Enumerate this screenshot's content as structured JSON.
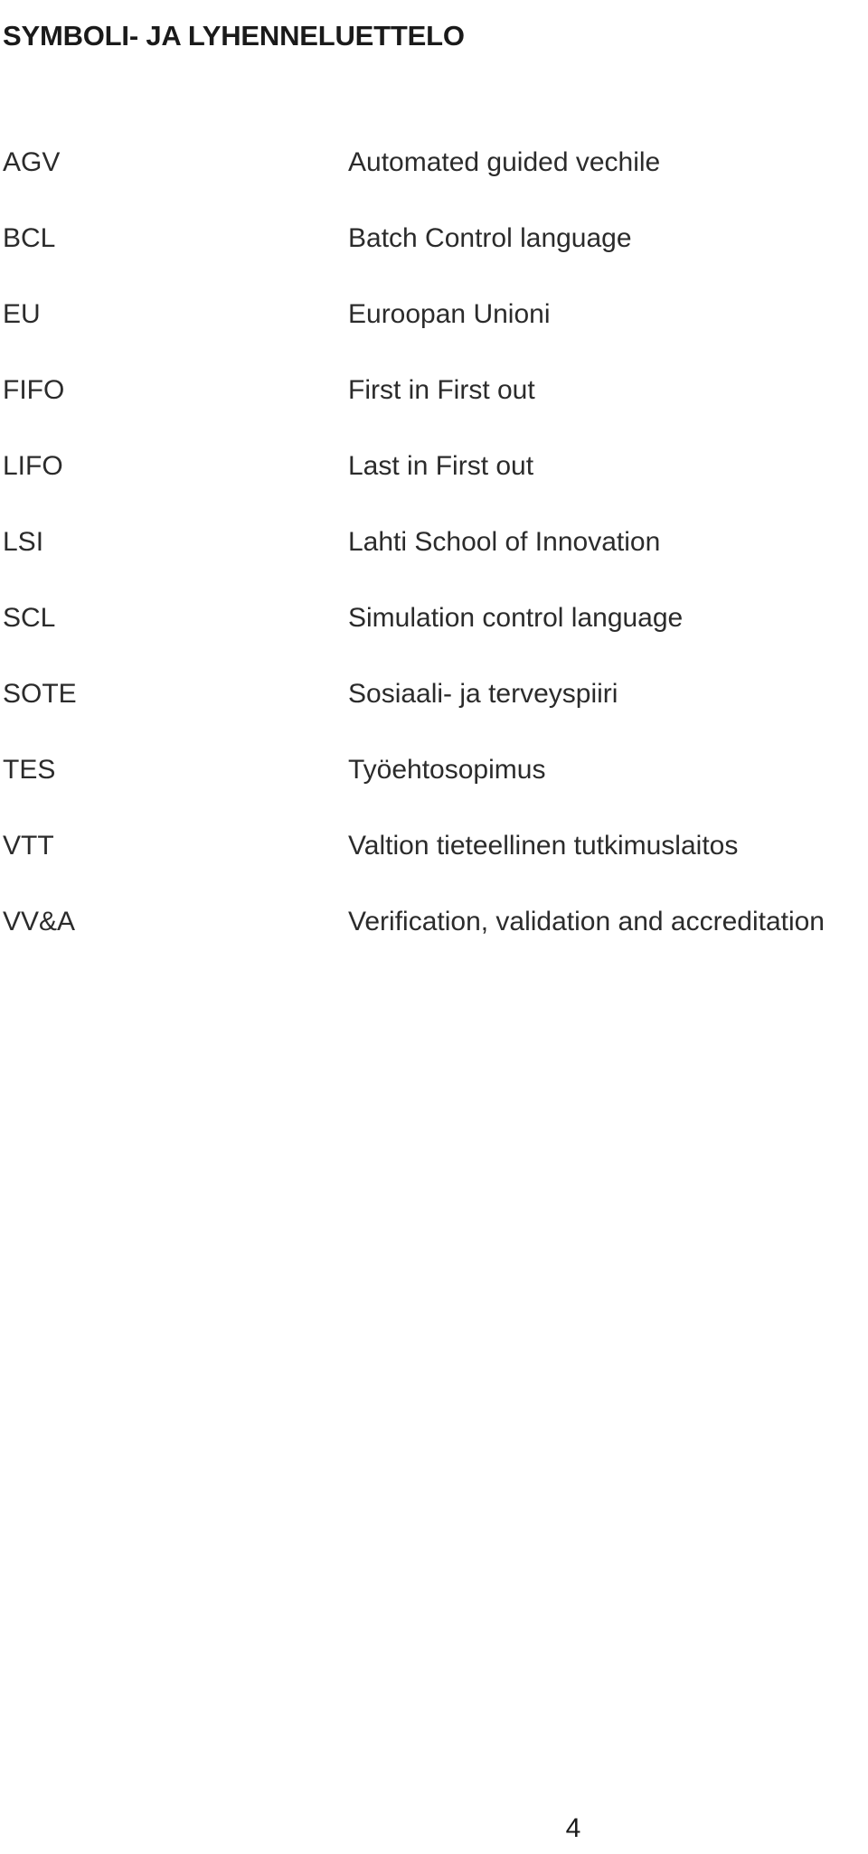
{
  "document": {
    "title": "SYMBOLI- JA LYHENNELUETTELO",
    "page_number": "4",
    "text_color": "#2b2b2b",
    "heading_color": "#1a1a1a",
    "background_color": "#ffffff"
  },
  "abbreviations": [
    {
      "term": "AGV",
      "definition": "Automated guided vechile"
    },
    {
      "term": "BCL",
      "definition": "Batch Control language"
    },
    {
      "term": "EU",
      "definition": "Euroopan Unioni"
    },
    {
      "term": "FIFO",
      "definition": "First in First out"
    },
    {
      "term": "LIFO",
      "definition": "Last in First out"
    },
    {
      "term": "LSI",
      "definition": "Lahti School of Innovation"
    },
    {
      "term": "SCL",
      "definition": "Simulation control language"
    },
    {
      "term": "SOTE",
      "definition": "Sosiaali- ja terveyspiiri"
    },
    {
      "term": "TES",
      "definition": "Työehtosopimus"
    },
    {
      "term": "VTT",
      "definition": "Valtion tieteellinen tutkimuslaitos"
    },
    {
      "term": "VV&A",
      "definition": "Verification, validation and accreditation"
    }
  ]
}
